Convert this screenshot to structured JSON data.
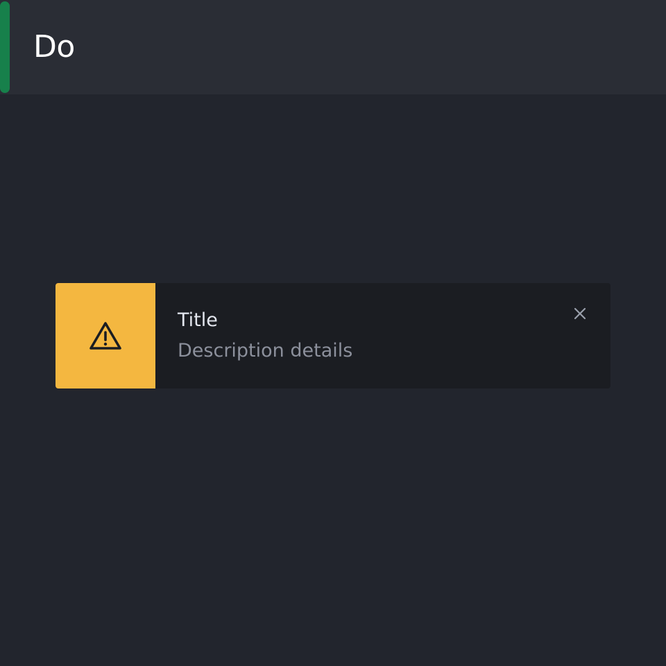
{
  "header": {
    "title": "Do",
    "accent_color": "#17804b"
  },
  "toast": {
    "variant": "warning",
    "icon": "warning-triangle-icon",
    "accent_color": "#f4b740",
    "title": "Title",
    "description": "Description details",
    "close_icon": "close-icon"
  }
}
